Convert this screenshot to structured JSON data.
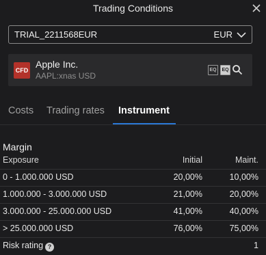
{
  "window": {
    "title": "Trading Conditions"
  },
  "account": {
    "id": "TRIAL_2211568EUR",
    "currency": "EUR"
  },
  "instrument": {
    "badge": "CFD",
    "name": "Apple Inc.",
    "symbol": "AAPL:xnas USD",
    "eq_icon_1": "EQ",
    "eq_icon_2": "EQ"
  },
  "tabs": [
    {
      "label": "Costs"
    },
    {
      "label": "Trading rates"
    },
    {
      "label": "Instrument"
    }
  ],
  "margin": {
    "title": "Margin",
    "headers": {
      "exposure": "Exposure",
      "initial": "Initial",
      "maint": "Maint."
    },
    "rows": [
      {
        "range": "0 - 1.000.000 USD",
        "initial": "20,00%",
        "maint": "10,00%"
      },
      {
        "range": "1.000.000 - 3.000.000 USD",
        "initial": "21,00%",
        "maint": "20,00%"
      },
      {
        "range": "3.000.000 - 25.000.000 USD",
        "initial": "41,00%",
        "maint": "40,00%"
      },
      {
        "range": "> 25.000.000 USD",
        "initial": "76,00%",
        "maint": "75,00%"
      }
    ],
    "risk_rating": {
      "label": "Risk rating",
      "value": "1",
      "help": "?"
    }
  },
  "colors": {
    "accent": "#2a78d6",
    "cfd_badge": "#b3322a",
    "background": "#1c1c1e"
  }
}
